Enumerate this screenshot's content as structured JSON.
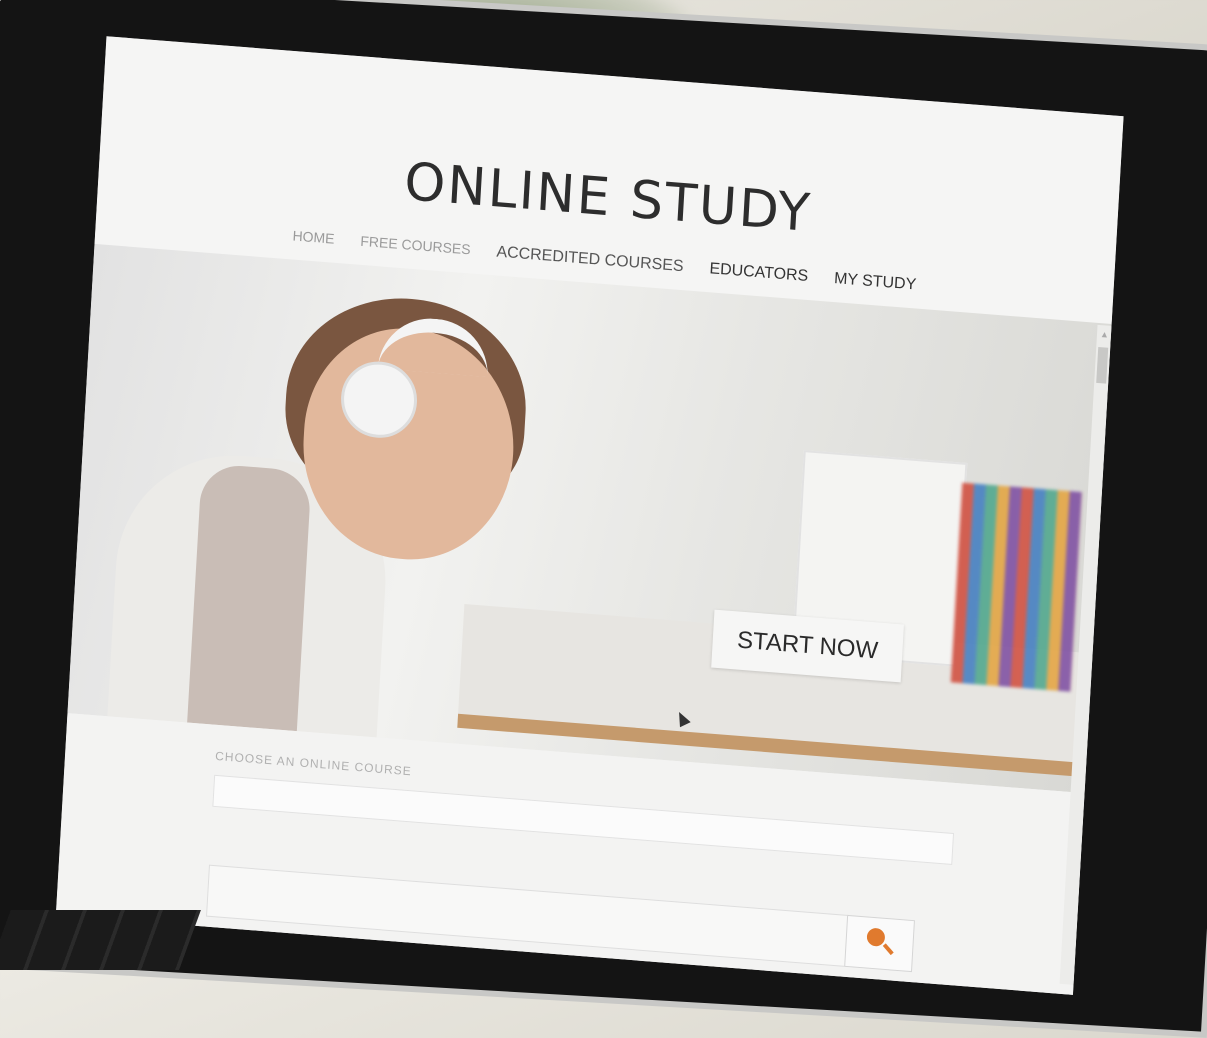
{
  "site": {
    "title": "ONLINE STUDY",
    "nav": [
      "HOME",
      "FREE COURSES",
      "ACCREDITED COURSES",
      "EDUCATORS",
      "MY STUDY"
    ]
  },
  "hero": {
    "cta_label": "START NOW"
  },
  "search": {
    "label": "CHOOSE AN ONLINE COURSE",
    "icon": "search-icon",
    "accent": "#e07a2e"
  }
}
